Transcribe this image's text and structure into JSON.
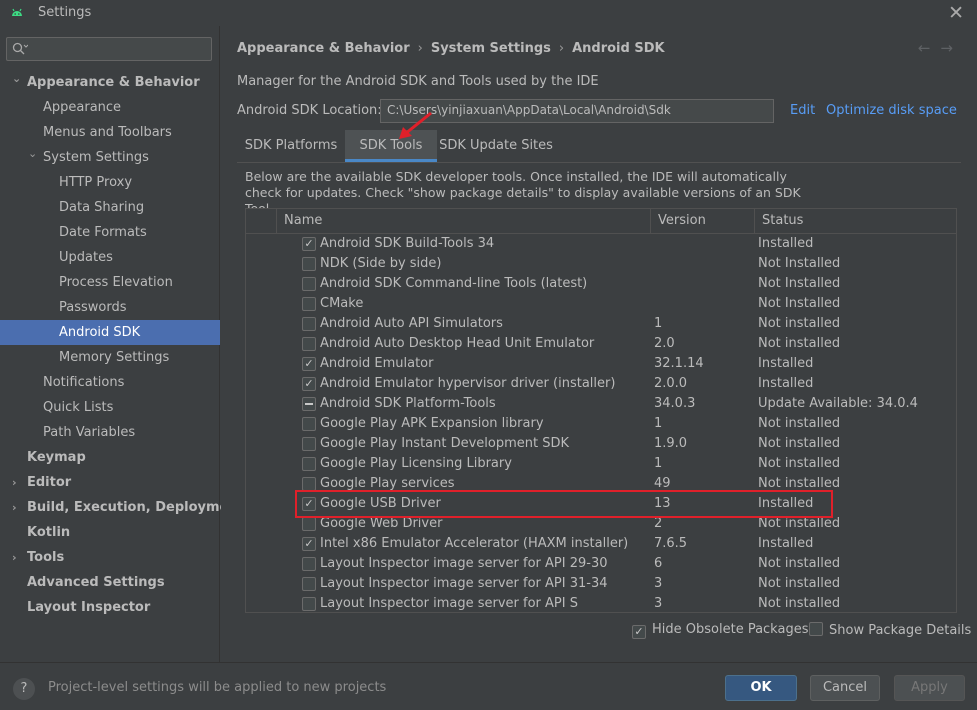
{
  "window": {
    "title": "Settings"
  },
  "search": {
    "placeholder": "Q•"
  },
  "sidebar": {
    "items": [
      {
        "label": "Appearance & Behavior",
        "bold": true,
        "level": 0,
        "arrow": "down"
      },
      {
        "label": "Appearance",
        "level": 1
      },
      {
        "label": "Menus and Toolbars",
        "level": 1
      },
      {
        "label": "System Settings",
        "level": 1,
        "arrow": "down"
      },
      {
        "label": "HTTP Proxy",
        "level": 2
      },
      {
        "label": "Data Sharing",
        "level": 2
      },
      {
        "label": "Date Formats",
        "level": 2
      },
      {
        "label": "Updates",
        "level": 2
      },
      {
        "label": "Process Elevation",
        "level": 2
      },
      {
        "label": "Passwords",
        "level": 2
      },
      {
        "label": "Android SDK",
        "level": 2,
        "selected": true
      },
      {
        "label": "Memory Settings",
        "level": 2
      },
      {
        "label": "Notifications",
        "level": 1
      },
      {
        "label": "Quick Lists",
        "level": 1
      },
      {
        "label": "Path Variables",
        "level": 1
      },
      {
        "label": "Keymap",
        "bold": true,
        "level": 0
      },
      {
        "label": "Editor",
        "bold": true,
        "level": 0,
        "arrow": "right"
      },
      {
        "label": "Build, Execution, Deployment",
        "bold": true,
        "level": 0,
        "arrow": "right"
      },
      {
        "label": "Kotlin",
        "bold": true,
        "level": 0
      },
      {
        "label": "Tools",
        "bold": true,
        "level": 0,
        "arrow": "right"
      },
      {
        "label": "Advanced Settings",
        "bold": true,
        "level": 0
      },
      {
        "label": "Layout Inspector",
        "bold": true,
        "level": 0
      }
    ]
  },
  "breadcrumb": {
    "items": [
      "Appearance & Behavior",
      "System Settings",
      "Android SDK"
    ]
  },
  "main": {
    "description": "Manager for the Android SDK and Tools used by the IDE",
    "location_label": "Android SDK Location:",
    "location_value": "C:\\Users\\yinjiaxuan\\AppData\\Local\\Android\\Sdk",
    "edit_link": "Edit",
    "optimize_link": "Optimize disk space",
    "tabs": [
      {
        "label": "SDK Platforms"
      },
      {
        "label": "SDK Tools",
        "active": true
      },
      {
        "label": "SDK Update Sites"
      }
    ],
    "tab_description": "Below are the available SDK developer tools. Once installed, the IDE will automatically check for updates. Check \"show package details\" to display available versions of an SDK Tool."
  },
  "table": {
    "headers": [
      "Name",
      "Version",
      "Status"
    ],
    "rows": [
      {
        "name": "Android SDK Build-Tools 34",
        "version": "",
        "status": "Installed",
        "check": "checked"
      },
      {
        "name": "NDK (Side by side)",
        "version": "",
        "status": "Not Installed",
        "check": "none"
      },
      {
        "name": "Android SDK Command-line Tools (latest)",
        "version": "",
        "status": "Not Installed",
        "check": "none"
      },
      {
        "name": "CMake",
        "version": "",
        "status": "Not Installed",
        "check": "none"
      },
      {
        "name": "Android Auto API Simulators",
        "version": "1",
        "status": "Not installed",
        "check": "none"
      },
      {
        "name": "Android Auto Desktop Head Unit Emulator",
        "version": "2.0",
        "status": "Not installed",
        "check": "none"
      },
      {
        "name": "Android Emulator",
        "version": "32.1.14",
        "status": "Installed",
        "check": "checked"
      },
      {
        "name": "Android Emulator hypervisor driver (installer)",
        "version": "2.0.0",
        "status": "Installed",
        "check": "checked"
      },
      {
        "name": "Android SDK Platform-Tools",
        "version": "34.0.3",
        "status": "Update Available: 34.0.4",
        "check": "partial"
      },
      {
        "name": "Google Play APK Expansion library",
        "version": "1",
        "status": "Not installed",
        "check": "none"
      },
      {
        "name": "Google Play Instant Development SDK",
        "version": "1.9.0",
        "status": "Not installed",
        "check": "none"
      },
      {
        "name": "Google Play Licensing Library",
        "version": "1",
        "status": "Not installed",
        "check": "none"
      },
      {
        "name": "Google Play services",
        "version": "49",
        "status": "Not installed",
        "check": "none"
      },
      {
        "name": "Google USB Driver",
        "version": "13",
        "status": "Installed",
        "check": "checked"
      },
      {
        "name": "Google Web Driver",
        "version": "2",
        "status": "Not installed",
        "check": "none"
      },
      {
        "name": "Intel x86 Emulator Accelerator (HAXM installer)",
        "version": "7.6.5",
        "status": "Installed",
        "check": "checked"
      },
      {
        "name": "Layout Inspector image server for API 29-30",
        "version": "6",
        "status": "Not installed",
        "check": "none"
      },
      {
        "name": "Layout Inspector image server for API 31-34",
        "version": "3",
        "status": "Not installed",
        "check": "none"
      },
      {
        "name": "Layout Inspector image server for API S",
        "version": "3",
        "status": "Not installed",
        "check": "none"
      }
    ]
  },
  "options": {
    "hide_obsolete": {
      "label": "Hide Obsolete Packages",
      "checked": true
    },
    "show_details": {
      "label": "Show Package Details",
      "checked": false
    }
  },
  "footer": {
    "help": "?",
    "text": "Project-level settings will be applied to new projects",
    "ok": "OK",
    "cancel": "Cancel",
    "apply": "Apply"
  },
  "colors": {
    "accent": "#4b6eaf",
    "link": "#589df6",
    "highlight_box": "#e0202a",
    "background": "#3c3f41"
  }
}
